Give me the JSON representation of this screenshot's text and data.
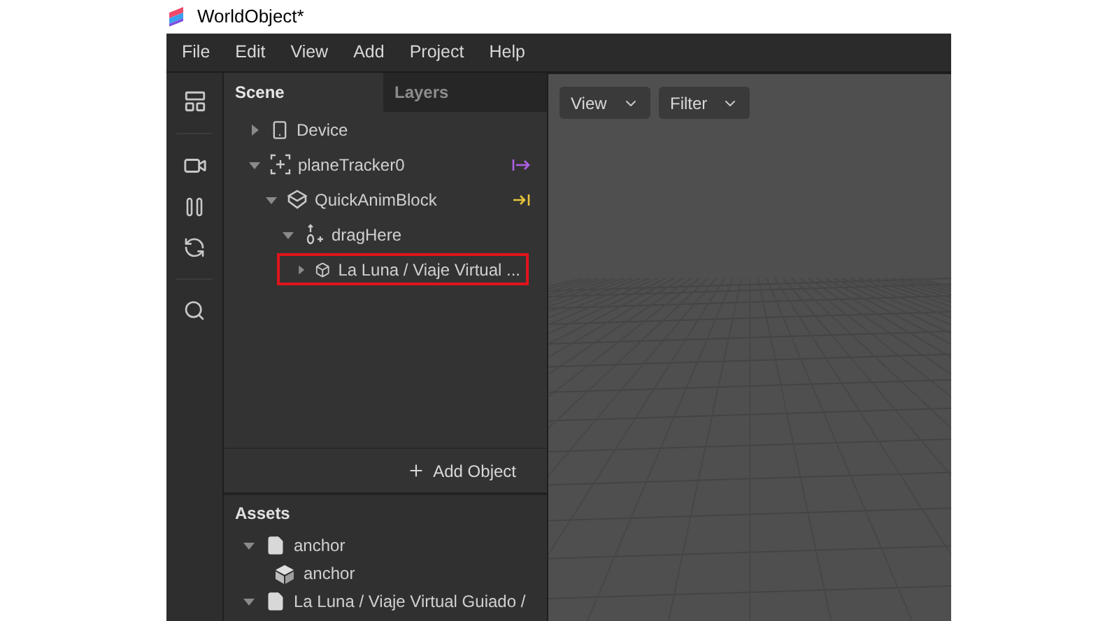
{
  "window": {
    "title": "WorldObject*"
  },
  "menu": [
    "File",
    "Edit",
    "View",
    "Add",
    "Project",
    "Help"
  ],
  "tabs": [
    {
      "label": "Scene",
      "selected": true
    },
    {
      "label": "Layers",
      "selected": false
    }
  ],
  "scene_tree": [
    {
      "label": "Device",
      "kind": "device",
      "expanded": false,
      "highlighted": false
    },
    {
      "label": "planeTracker0",
      "kind": "tracker",
      "expanded": true,
      "highlighted": false,
      "link": {
        "kind": "out"
      },
      "children": [
        {
          "label": "QuickAnimBlock",
          "kind": "block",
          "expanded": true,
          "highlighted": false,
          "link": {
            "kind": "in"
          },
          "children": [
            {
              "label": "dragHere",
              "kind": "drag",
              "expanded": true,
              "highlighted": false,
              "children": [
                {
                  "label": "La Luna / Viaje Virtual ...",
                  "kind": "object",
                  "expanded": false,
                  "highlighted": true
                }
              ]
            }
          ]
        }
      ]
    }
  ],
  "add_object": "Add Object",
  "assets": {
    "title": "Assets",
    "items": [
      {
        "label": "anchor",
        "kind": "file",
        "expanded": true,
        "children": [
          {
            "label": "anchor",
            "kind": "mesh"
          }
        ]
      },
      {
        "label": "La Luna / Viaje Virtual Guiado /",
        "kind": "file",
        "expanded": true
      }
    ]
  },
  "viewport": {
    "dropdowns": [
      "View",
      "Filter"
    ]
  }
}
